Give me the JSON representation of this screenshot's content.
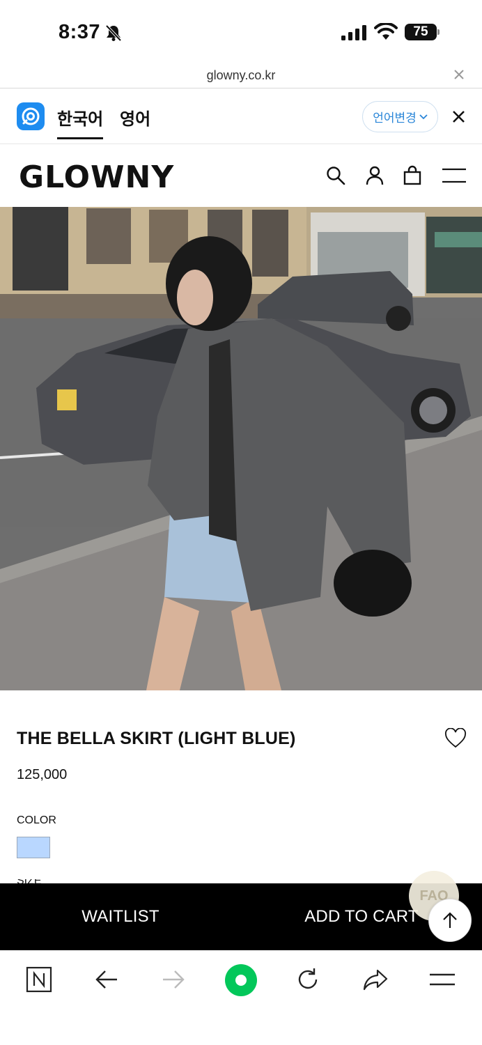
{
  "status_bar": {
    "time": "8:37",
    "battery": "75",
    "battery_fraction": 0.75,
    "icons": [
      "bell-off-icon",
      "cellular-signal-icon",
      "wifi-icon",
      "battery-icon"
    ]
  },
  "url_bar": {
    "domain": "glowny.co.kr"
  },
  "translate_bar": {
    "tabs": [
      {
        "label": "한국어",
        "active": true
      },
      {
        "label": "영어",
        "active": false
      }
    ],
    "change_language": "언어변경"
  },
  "header": {
    "logo": "GLOWNY",
    "icons": [
      "search-icon",
      "user-icon",
      "cart-icon",
      "menu-icon"
    ]
  },
  "product": {
    "title": "THE BELLA SKIRT (LIGHT BLUE)",
    "price": "125,000",
    "color_label": "COLOR",
    "swatch_color": "#b9d7ff",
    "next_label": "SIZE"
  },
  "actions": {
    "waitlist": "WAITLIST",
    "add_to_cart": "ADD TO CART",
    "faq": "FAQ"
  },
  "browser_toolbar": {
    "icons": [
      "naver-home-icon",
      "back-icon",
      "forward-icon",
      "green-dot-icon",
      "reload-icon",
      "share-icon",
      "menu-icon"
    ]
  },
  "colors": {
    "accent": "#1e8cf0",
    "action_bar": "#000000",
    "green": "#03c75a"
  }
}
